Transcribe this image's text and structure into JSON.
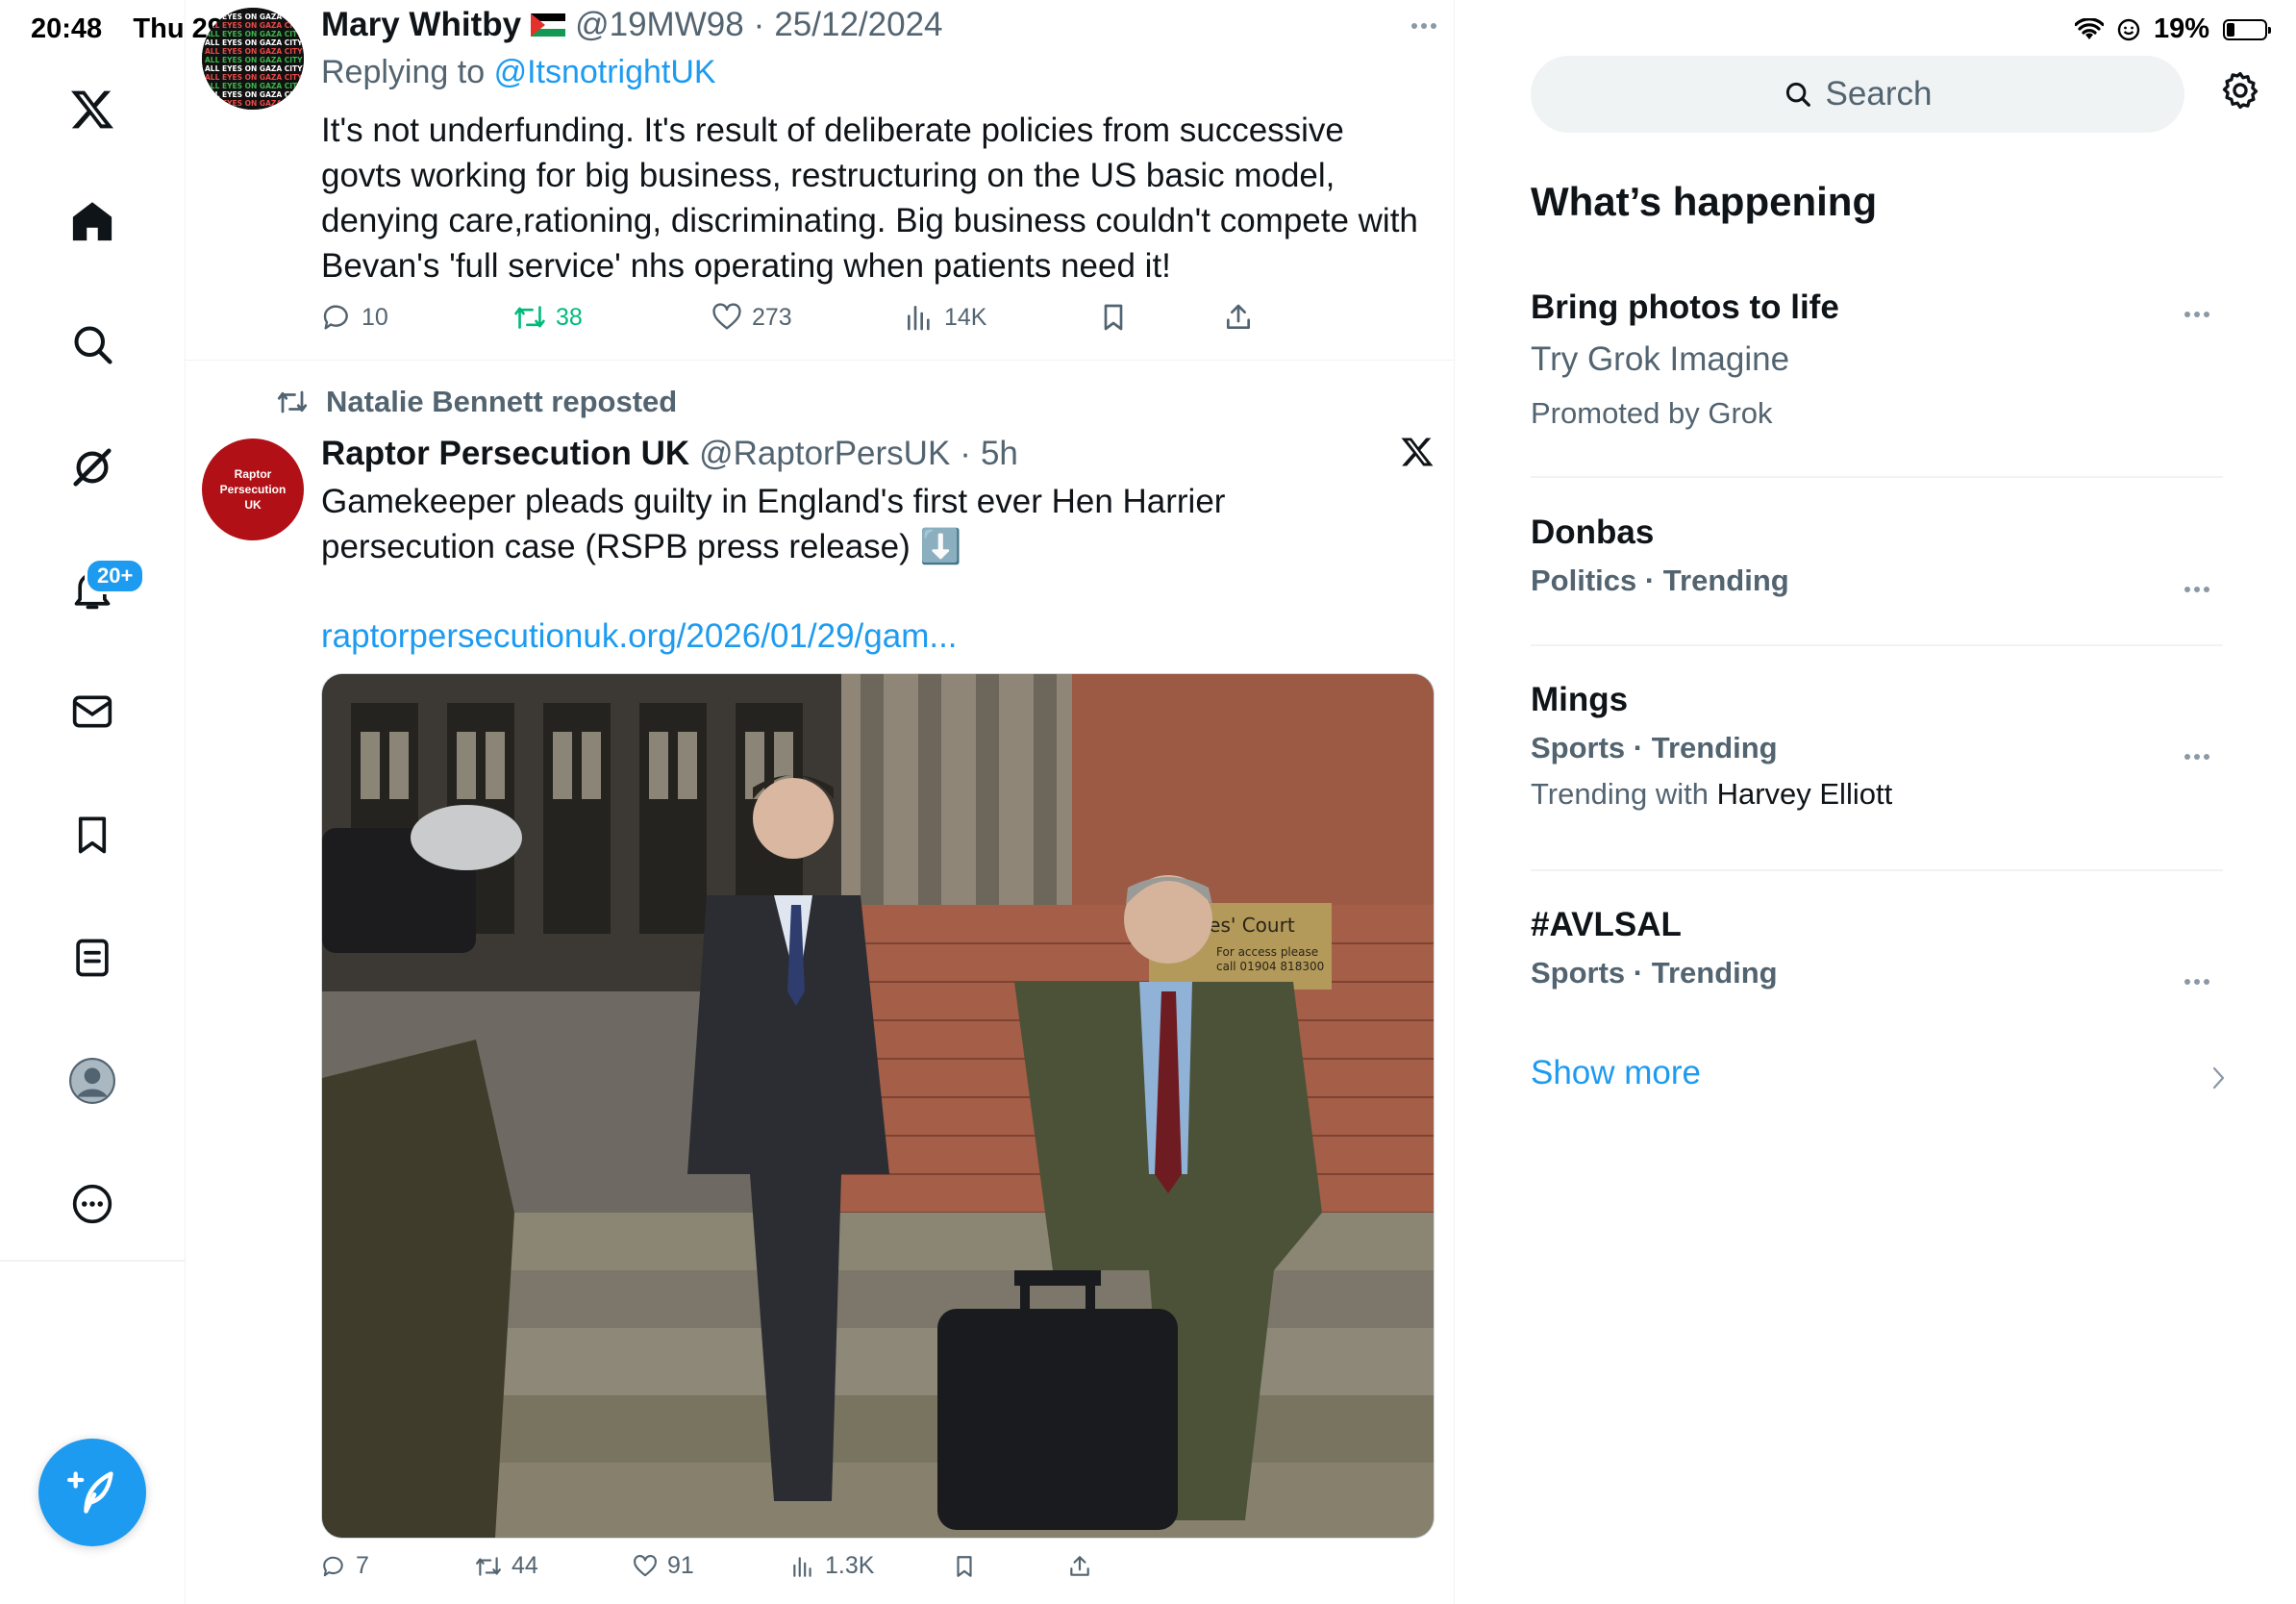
{
  "status": {
    "time": "20:48",
    "day": "Thu 29",
    "battery": "19%",
    "battery_level": 0.19
  },
  "nav": {
    "items": [
      {
        "name": "x-logo",
        "label": "X"
      },
      {
        "name": "home",
        "label": "Home"
      },
      {
        "name": "explore",
        "label": "Explore"
      },
      {
        "name": "grok",
        "label": "Grok"
      },
      {
        "name": "notifications",
        "label": "Notifications",
        "badge": "20+"
      },
      {
        "name": "messages",
        "label": "Messages"
      },
      {
        "name": "bookmarks",
        "label": "Bookmarks"
      },
      {
        "name": "lists",
        "label": "Lists"
      },
      {
        "name": "profile",
        "label": "Profile"
      },
      {
        "name": "more",
        "label": "More"
      }
    ],
    "notifications_badge": "20+"
  },
  "tweets": [
    {
      "author": "Mary Whitby",
      "flag": "🇵🇸",
      "handle": "@19MW98",
      "sep": "·",
      "date": "25/12/2024",
      "reply_prefix": "Replying to",
      "reply_to": "@ItsnotrightUK",
      "text": "It's not underfunding. It's result of deliberate policies from successive govts working for big business, restructuring on the US basic model, denying care,rationing, discriminating. Big business couldn't compete with Bevan's 'full service' nhs operating when patients need it!",
      "replies": "10",
      "reposts": "38",
      "likes": "273",
      "views": "14K",
      "avatar_lines": [
        "ALL EYES ON GAZA CITY"
      ]
    },
    {
      "reposted_by": "Natalie Bennett reposted",
      "author": "Raptor Persecution UK",
      "handle": "@RaptorPersUK",
      "sep": "·",
      "time": "5h",
      "avatar_text": [
        "Raptor",
        "Persecution",
        "UK"
      ],
      "text": "Gamekeeper pleads guilty in England's first ever Hen Harrier persecution case (RSPB press release) ⬇️",
      "link": "raptorpersecutionuk.org/2026/01/29/gam...",
      "photo_sign": [
        "istrates' Court",
        "For access please",
        "call 01904 818300"
      ],
      "replies": "7",
      "reposts": "44",
      "likes": "91",
      "views": "1.3K"
    }
  ],
  "sidebar": {
    "search_placeholder": "Search",
    "title": "What’s happening",
    "trends": [
      {
        "title": "Bring photos to life",
        "line1": "Try Grok Imagine",
        "line2": "Promoted by Grok"
      },
      {
        "title": "Donbas",
        "meta": "Politics · Trending"
      },
      {
        "title": "Mings",
        "meta": "Sports · Trending",
        "with_prefix": "Trending with",
        "with_name": "Harvey Elliott"
      },
      {
        "title": "#AVLSAL",
        "meta": "Sports · Trending"
      }
    ],
    "show_more": "Show more"
  },
  "colors": {
    "accent": "#1d9bf0",
    "repost_green": "#00ba7c",
    "secondary_text": "#536471",
    "divider": "#eff3f4"
  }
}
